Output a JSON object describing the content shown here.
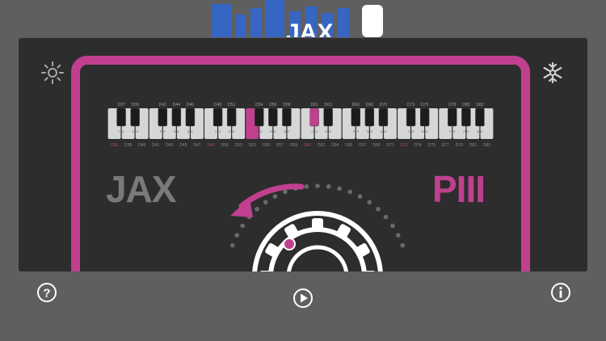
{
  "app": {
    "logo_text": "JAX",
    "accent_color": "#c0408f",
    "logo_color": "#3566c4"
  },
  "panel": {
    "left_label": "JAX",
    "right_label": "PIII",
    "settings_icon": "sun-icon",
    "freeze_icon": "snowflake-icon"
  },
  "keyboard": {
    "black_key_labels": [
      "D37",
      "D39",
      "D42",
      "D44",
      "D46",
      "D49",
      "D51",
      "D54",
      "D56",
      "D58",
      "D61",
      "D63",
      "D66",
      "D68",
      "D70",
      "D73",
      "D75",
      "D78",
      "D80",
      "D82"
    ],
    "white_key_labels": [
      "D36",
      "D38",
      "D40",
      "D41",
      "D43",
      "D45",
      "D47",
      "D48",
      "D50",
      "D52",
      "D53",
      "D55",
      "D57",
      "D59",
      "D60",
      "D62",
      "D64",
      "D65",
      "D67",
      "D69",
      "D71",
      "D72",
      "D74",
      "D76",
      "D77",
      "D79",
      "D81",
      "D83"
    ],
    "lower_white_labels": [
      "C41",
      "C43",
      "F41",
      "G41",
      "A41",
      "C42",
      "D42",
      "F42",
      "G42",
      "A42",
      "C43",
      "D43",
      "F43",
      "G43",
      "A43",
      "C44",
      "D44",
      "F44",
      "G44",
      "A44"
    ],
    "highlighted_white_index": 10,
    "highlighted_black_index": 10
  },
  "toolbar": {
    "help_icon": "question-icon",
    "play_icon": "play-icon",
    "info_icon": "info-icon"
  }
}
